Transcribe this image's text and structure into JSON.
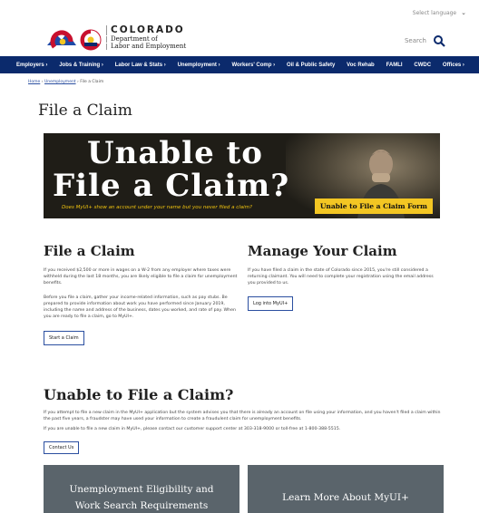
{
  "header": {
    "language": "Select language",
    "agency": "COLORADO",
    "department_line1": "Department of",
    "department_line2": "Labor and Employment",
    "search_label": "Search"
  },
  "nav": {
    "items": [
      "Employers ›",
      "Jobs & Training ›",
      "Labor Law & Stats ›",
      "Unemployment ›",
      "Workers' Comp ›",
      "Oil & Public Safety",
      "Voc Rehab",
      "FAMLI",
      "CWDC",
      "Offices ›"
    ]
  },
  "breadcrumb": {
    "home": "Home",
    "sep": "›",
    "unemployment": "Unemployment",
    "current": "File a Claim"
  },
  "page_title": "File a Claim",
  "banner": {
    "line1": "Unable to",
    "line2": "File a Claim?",
    "question": "Does MyUI+ show an account under your name but you never filed a claim?",
    "button": "Unable to File a Claim Form"
  },
  "file_claim": {
    "heading": "File a Claim",
    "p1": "If you received $2,500 or more in wages on a W-2 from any employer where taxes were withheld during the last 18 months, you are likely eligible to file a claim for unemployment benefits.",
    "p2": "Before you file a claim, gather your income-related information, such as pay stubs. Be prepared to provide information about work you have performed since January 2019, including the name and address of the business, dates you worked, and rate of pay. When you are ready to file a claim, go to MyUI+.",
    "button": "Start a Claim"
  },
  "manage_claim": {
    "heading": "Manage Your Claim",
    "p1": "If you have filed a claim in the state of Colorado since 2015, you're still considered a returning claimant. You will need to complete your registration using the email address you provided to us.",
    "button": "Log into MyUI+"
  },
  "unable_section": {
    "heading": "Unable to File a Claim?",
    "p1": "If you attempt to file a new claim in the MyUI+ application but the system advises you that there is already an account on file using your information, and you haven't filed a claim within the past five years, a fraudster may have used your information to create a fraudulent claim for unemployment benefits.",
    "p2": "If you are unable to file a new claim in MyUI+, please contact our customer support center at 303-318-9000 or toll-free at 1-800-388-5515.",
    "button": "Contact Us"
  },
  "tiles": {
    "left_line1": "Unemployment Eligibility and",
    "left_line2": "Work Search Requirements",
    "right": "Learn More About MyUI+"
  },
  "colors": {
    "nav_bg": "#0b2a6c",
    "banner_button": "#f3c623",
    "tile_bg": "#5a646b",
    "link": "#2b4fa0"
  }
}
